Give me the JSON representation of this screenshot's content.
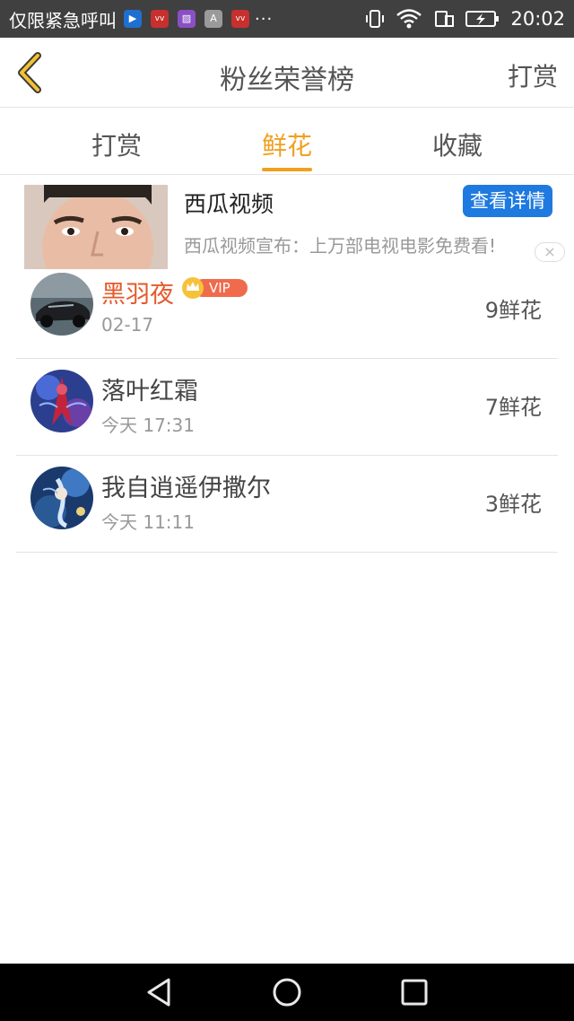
{
  "status_bar": {
    "left_text": "仅限紧急呼叫",
    "app_icons": [
      {
        "name": "video-app-icon",
        "label": "▶",
        "color": "#1f6fd1"
      },
      {
        "name": "vivo-app-icon",
        "label": "vv",
        "color": "#c7302e"
      },
      {
        "name": "gallery-app-icon",
        "label": "▨",
        "color": "#8a4fc5"
      },
      {
        "name": "a-app-icon",
        "label": "A",
        "color": "#9a9a9a"
      },
      {
        "name": "vivo-app-icon-2",
        "label": "vv",
        "color": "#c7302e"
      }
    ],
    "more": "···",
    "time": "20:02"
  },
  "header": {
    "title": "粉丝荣誉榜",
    "action": "打赏"
  },
  "tabs": [
    {
      "label": "打赏",
      "active": false
    },
    {
      "label": "鲜花",
      "active": true
    },
    {
      "label": "收藏",
      "active": false
    }
  ],
  "ad": {
    "title": "西瓜视频",
    "button": "查看详情",
    "description": "西瓜视频宣布：上万部电视电影免费看!",
    "close": "×"
  },
  "fans": [
    {
      "name": "黑羽夜",
      "date": "02-17",
      "count": "9鲜花",
      "vip": true,
      "vip_label": "VIP"
    },
    {
      "name": "落叶红霜",
      "date": "今天 17:31",
      "count": "7鲜花",
      "vip": false
    },
    {
      "name": "我自逍遥伊撒尔",
      "date": "今天 11:11",
      "count": "3鲜花",
      "vip": false
    }
  ],
  "colors": {
    "accent": "#f0a020",
    "vip_name": "#e45a2b",
    "ad_button": "#1f7ae0",
    "status_bar": "#404040"
  }
}
